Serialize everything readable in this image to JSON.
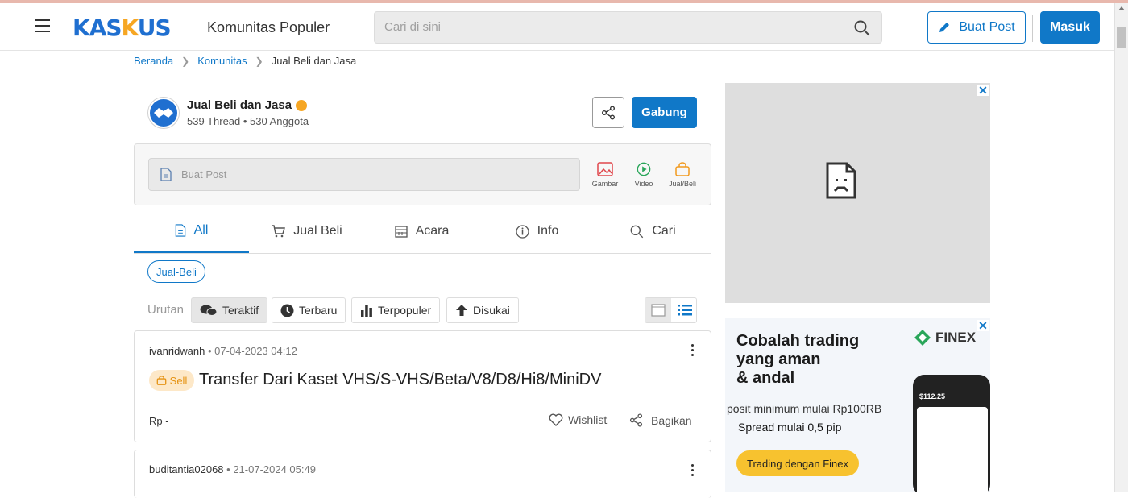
{
  "nav": {
    "logo": "KASKUS",
    "title": "Komunitas Populer",
    "search_placeholder": "Cari di sini",
    "buat_post": "Buat Post",
    "masuk": "Masuk"
  },
  "breadcrumb": [
    "Beranda",
    "Komunitas",
    "Jual Beli dan Jasa"
  ],
  "community": {
    "name": "Jual Beli dan Jasa",
    "stats": "539 Thread • 530 Anggota",
    "join": "Gabung"
  },
  "composer": {
    "placeholder": "Buat Post",
    "actions": [
      "Gambar",
      "Video",
      "Jual/Beli"
    ]
  },
  "tabs": [
    "All",
    "Jual Beli",
    "Acara",
    "Info",
    "Cari"
  ],
  "filter_chip": "Jual-Beli",
  "sort": {
    "label": "Urutan",
    "options": [
      "Teraktif",
      "Terbaru",
      "Terpopuler",
      "Disukai"
    ]
  },
  "posts": [
    {
      "user": "ivanridwanh",
      "date": "• 07-04-2023 04:12",
      "tag": "Sell",
      "title": "Transfer Dari Kaset VHS/S-VHS/Beta/V8/D8/Hi8/MiniDV",
      "price": "Rp -",
      "wishlist": "Wishlist",
      "share": "Bagikan"
    },
    {
      "user": "buditantia02068",
      "date": "• 21-07-2024 05:49"
    }
  ],
  "ad": {
    "headline1": "Cobalah trading",
    "headline2": "yang aman",
    "headline3": "& andal",
    "brand": "FINEX",
    "line1": "posit minimum mulai Rp100RB",
    "line2": "Spread mulai 0,5 pip",
    "cta": "Trading dengan Finex",
    "phone_balance": "$112.25"
  },
  "colors": {
    "primary": "#1078c8",
    "accent": "#f6a623"
  }
}
